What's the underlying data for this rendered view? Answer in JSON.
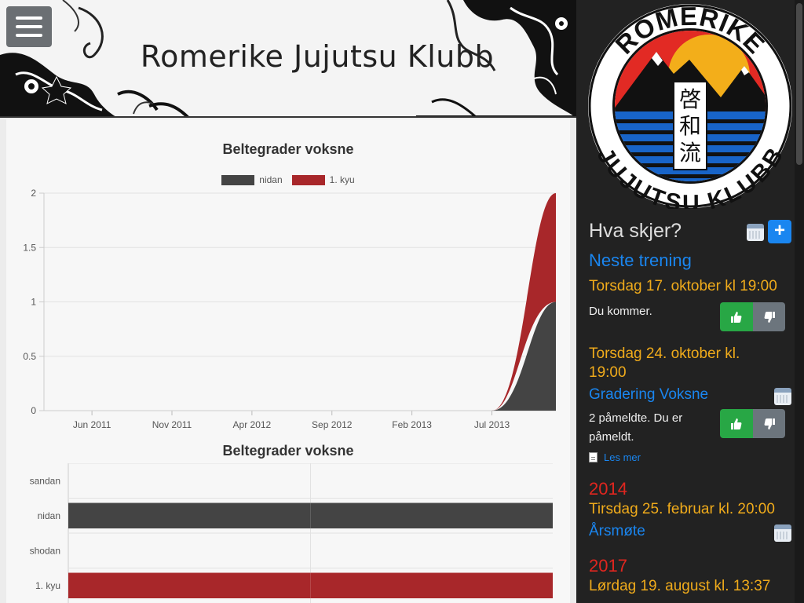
{
  "header": {
    "title": "Romerike Jujutsu Klubb",
    "menu_icon": "hamburger-menu-icon"
  },
  "colors": {
    "nidan": "#444444",
    "kyu1": "#a8272a",
    "accent_blue": "#1a86f0",
    "date_orange": "#f0ab1b",
    "year_red": "#e0261f"
  },
  "chart_data": [
    {
      "type": "area",
      "title": "Beltegrader voksne",
      "legend": [
        "nidan",
        "1. kyu"
      ],
      "legend_position": "top",
      "stacked": true,
      "x_ticks": [
        "Jun 2011",
        "Nov 2011",
        "Apr 2012",
        "Sep 2012",
        "Feb 2013",
        "Jul 2013"
      ],
      "y_ticks": [
        "0",
        "0.5",
        "1",
        "1.5",
        "2"
      ],
      "ylim": [
        0,
        2
      ],
      "xlim": [
        "2011-03",
        "2013-11"
      ],
      "grid": true,
      "series": [
        {
          "name": "nidan",
          "x": [
            "2011-03",
            "2013-07",
            "2013-11"
          ],
          "values": [
            0,
            0,
            1
          ]
        },
        {
          "name": "1. kyu",
          "x": [
            "2011-03",
            "2013-07",
            "2013-11"
          ],
          "values": [
            0,
            0,
            1
          ]
        }
      ]
    },
    {
      "type": "bar",
      "orientation": "horizontal",
      "title": "Beltegrader voksne",
      "categories": [
        "sandan",
        "nidan",
        "shodan",
        "1. kyu"
      ],
      "values": [
        0,
        1,
        0,
        1
      ],
      "xlim": [
        0,
        1
      ],
      "grid": true
    }
  ],
  "sidebar": {
    "logo": {
      "top_text": "ROMERIKE",
      "bottom_text": "JUJUTSU KLUBB",
      "kanji": [
        "啓",
        "和",
        "流"
      ]
    },
    "heading": "Hva skjer?",
    "calendar_icon": "calendar-icon",
    "add_button": "+",
    "next_training": "Neste trening",
    "event1": {
      "date": "Torsdag 17. oktober kl 19:00",
      "status": "Du kommer."
    },
    "event2": {
      "date_line1": "Torsdag 24. oktober kl.",
      "date_line2": "19:00",
      "title": "Gradering Voksne",
      "status_line1": "2 påmeldte. Du er",
      "status_line2": "påmeldt.",
      "link": "Les mer"
    },
    "year1": "2014",
    "event3": {
      "date": "Tirsdag 25. februar kl. 20:00",
      "title": "Årsmøte"
    },
    "year2": "2017",
    "event4": {
      "date": "Lørdag 19. august kl. 13:37"
    }
  }
}
